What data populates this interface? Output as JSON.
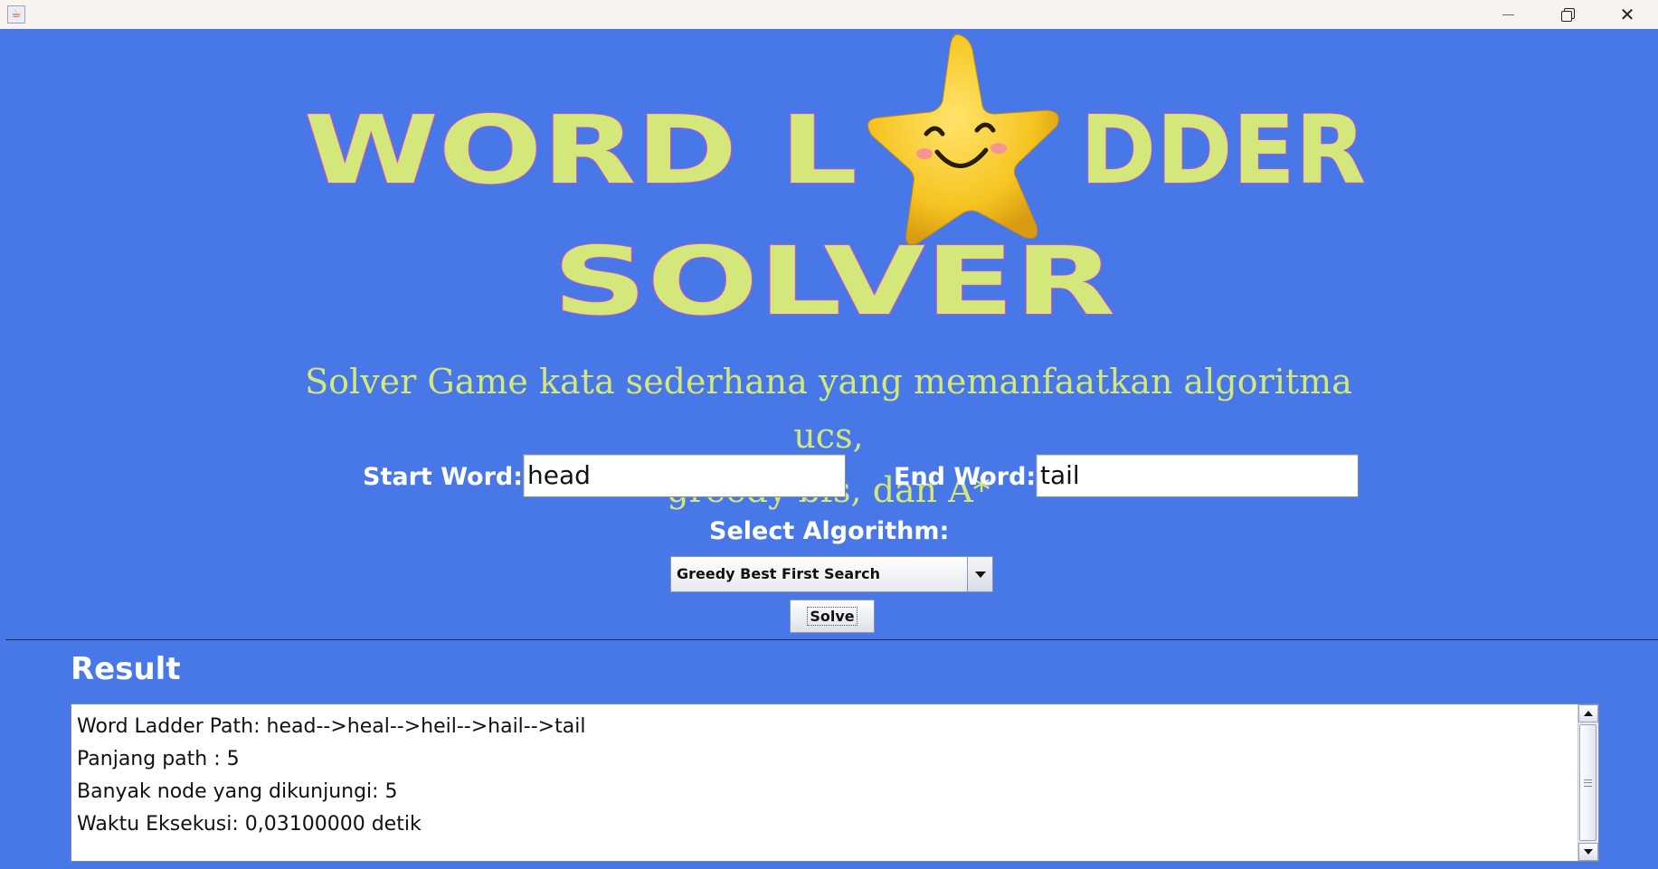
{
  "window": {
    "minimize_glyph": "",
    "close_glyph": "✕"
  },
  "logo": {
    "line1_left": "WORD L",
    "line1_right": "DDER",
    "line2": "SOLVER"
  },
  "subtitle": {
    "line1": "Solver Game kata sederhana yang memanfaatkan algoritma ucs,",
    "line2": "greedy bfs, dan A*"
  },
  "form": {
    "start_label": "Start Word:",
    "start_value": "head",
    "end_label": "End Word:",
    "end_value": "tail",
    "algorithm_label": "Select Algorithm:",
    "algorithm_selected": "Greedy Best First Search",
    "solve_label": "Solve"
  },
  "result": {
    "title": "Result",
    "lines": [
      "Word Ladder Path: head-->heal-->heil-->hail-->tail",
      "Panjang path : 5",
      "Banyak node yang dikunjungi: 5",
      "Waktu Eksekusi: 0,03100000 detik"
    ]
  },
  "colors": {
    "background": "#4878e8",
    "logo_fill": "#d3e77a",
    "logo_outline": "#e34fb8",
    "star": "#f6c421"
  }
}
